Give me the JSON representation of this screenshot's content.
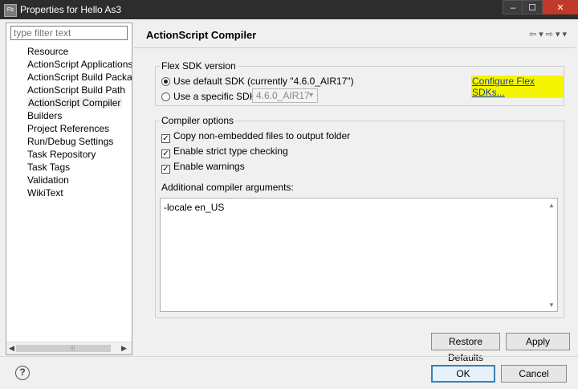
{
  "window": {
    "app_icon_text": "Fb",
    "title": "Properties for Hello As3",
    "minimize": "–",
    "maximize": "☐",
    "close": "✕"
  },
  "sidebar": {
    "filter_placeholder": "type filter text",
    "items": [
      {
        "label": "Resource"
      },
      {
        "label": "ActionScript Applications"
      },
      {
        "label": "ActionScript Build Packagi"
      },
      {
        "label": "ActionScript Build Path"
      },
      {
        "label": "ActionScript Compiler",
        "selected": true
      },
      {
        "label": "Builders"
      },
      {
        "label": "Project References"
      },
      {
        "label": "Run/Debug Settings"
      },
      {
        "label": "Task Repository"
      },
      {
        "label": "Task Tags"
      },
      {
        "label": "Validation"
      },
      {
        "label": "WikiText"
      }
    ]
  },
  "page": {
    "title": "ActionScript Compiler",
    "nav_back": "⇦",
    "nav_back_menu": "▾",
    "nav_forward": "⇨",
    "nav_forward_menu": "▾",
    "view_menu": "▾"
  },
  "sdk": {
    "group_label": "Flex SDK version",
    "default_option": "Use default SDK (currently \"4.6.0_AIR17\")",
    "specific_option": "Use a specific SDK:",
    "specific_value": "4.6.0_AIR17",
    "configure_link": "Configure Flex SDKs...",
    "selected": "default"
  },
  "compiler": {
    "group_label": "Compiler options",
    "options": [
      {
        "label": "Copy non-embedded files to output folder",
        "checked": true
      },
      {
        "label": "Enable strict type checking",
        "checked": true
      },
      {
        "label": "Enable warnings",
        "checked": true
      }
    ],
    "args_label": "Additional compiler arguments:",
    "args_value": "-locale en_US"
  },
  "buttons": {
    "restore_defaults": "Restore Defaults",
    "apply": "Apply",
    "ok": "OK",
    "cancel": "Cancel",
    "help": "?"
  },
  "colors": {
    "link": "#1a3ea8",
    "link_highlight": "#f5f500",
    "primary_border": "#3c7fb1"
  }
}
